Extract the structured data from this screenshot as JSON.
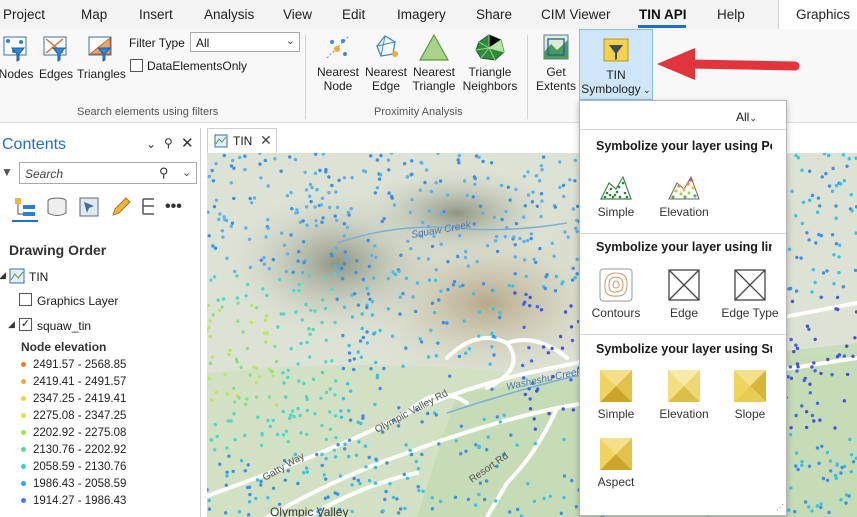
{
  "menu": {
    "items": [
      "Project",
      "Map",
      "Insert",
      "Analysis",
      "View",
      "Edit",
      "Imagery",
      "Share",
      "CIM Viewer",
      "TIN API",
      "Help"
    ],
    "active": "TIN API",
    "graphics_tab": "Graphics"
  },
  "ribbon": {
    "search_group": {
      "nodes": "Nodes",
      "edges": "Edges",
      "triangles": "Triangles",
      "filter_type_label": "Filter Type",
      "filter_type_value": "All",
      "data_elements_only": "DataElementsOnly",
      "group_label": "Search elements using filters"
    },
    "proximity_group": {
      "nearest_node": [
        "Nearest",
        "Node"
      ],
      "nearest_edge": [
        "Nearest",
        "Edge"
      ],
      "nearest_triangle": [
        "Nearest",
        "Triangle"
      ],
      "triangle_neighbors": [
        "Triangle",
        "Neighbors"
      ],
      "group_label": "Proximity Analysis"
    },
    "get_extents": [
      "Get",
      "Extents"
    ],
    "tin_symbology": [
      "TIN",
      "Symbology"
    ]
  },
  "contents": {
    "title": "Contents",
    "search_placeholder": "Search",
    "drawing_order": "Drawing Order",
    "map_name": "TIN",
    "graphics_layer": "Graphics Layer",
    "layer_name": "squaw_tin",
    "legend_title": "Node elevation",
    "legend": [
      {
        "label": "2491.57 - 2568.85",
        "color": "#f07d2a"
      },
      {
        "label": "2419.41 - 2491.57",
        "color": "#f4a52b"
      },
      {
        "label": "2347.25 - 2419.41",
        "color": "#f0d23a"
      },
      {
        "label": "2275.08 - 2347.25",
        "color": "#d9e83c"
      },
      {
        "label": "2202.92 - 2275.08",
        "color": "#a8e34a"
      },
      {
        "label": "2130.76 - 2202.92",
        "color": "#63d98a"
      },
      {
        "label": "2058.59 - 2130.76",
        "color": "#2fcfcf"
      },
      {
        "label": "1986.43 - 2058.59",
        "color": "#2aa7e8"
      },
      {
        "label": "1914.27 - 1986.43",
        "color": "#3a7ae6"
      }
    ]
  },
  "map": {
    "tab_label": "TIN",
    "labels": [
      "Squaw Creek",
      "Olympic Valley Rd",
      "Washeshu Creek",
      "Resort Rd",
      "Gatty Way",
      "Olympic Valley"
    ]
  },
  "gallery": {
    "filter": "All",
    "sections": [
      {
        "title": "Symbolize your layer using Points",
        "items": [
          "Simple",
          "Elevation"
        ]
      },
      {
        "title": "Symbolize your layer using lines",
        "items": [
          "Contours",
          "Edge",
          "Edge Type"
        ]
      },
      {
        "title": "Symbolize your layer using Surfaces",
        "items": [
          "Simple",
          "Elevation",
          "Slope",
          "Aspect"
        ]
      }
    ]
  },
  "colors": {
    "accent": "#1f6fc6",
    "arrow": "#e0353b",
    "selected": "#cfe6f8"
  }
}
